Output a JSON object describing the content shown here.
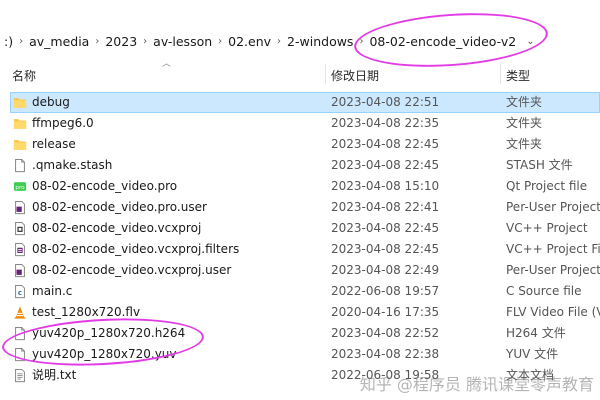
{
  "breadcrumb": {
    "items": [
      ":)",
      "av_media",
      "2023",
      "av-lesson",
      "02.env",
      "2-windows",
      "08-02-encode_video-v2"
    ]
  },
  "header": {
    "name": "名称",
    "date": "修改日期",
    "type": "类型"
  },
  "files": [
    {
      "name": "debug",
      "date": "2023-04-08 22:51",
      "type": "文件夹",
      "icon": "folder-icon"
    },
    {
      "name": "ffmpeg6.0",
      "date": "2023-04-08 22:35",
      "type": "文件夹",
      "icon": "folder-icon"
    },
    {
      "name": "release",
      "date": "2023-04-08 22:45",
      "type": "文件夹",
      "icon": "folder-icon"
    },
    {
      "name": ".qmake.stash",
      "date": "2023-04-08 22:45",
      "type": "STASH 文件",
      "icon": "file-icon"
    },
    {
      "name": "08-02-encode_video.pro",
      "date": "2023-04-08 15:10",
      "type": "Qt Project file",
      "icon": "qt-pro-icon"
    },
    {
      "name": "08-02-encode_video.pro.user",
      "date": "2023-04-08 22:41",
      "type": "Per-User Project",
      "icon": "user-project-icon"
    },
    {
      "name": "08-02-encode_video.vcxproj",
      "date": "2023-04-08 22:45",
      "type": "VC++ Project",
      "icon": "vcxproj-icon"
    },
    {
      "name": "08-02-encode_video.vcxproj.filters",
      "date": "2023-04-08 22:45",
      "type": "VC++ Project Filt",
      "icon": "vcxproj-filters-icon"
    },
    {
      "name": "08-02-encode_video.vcxproj.user",
      "date": "2023-04-08 22:49",
      "type": "Per-User Project",
      "icon": "user-project-icon"
    },
    {
      "name": "main.c",
      "date": "2022-06-08 19:57",
      "type": "C Source file",
      "icon": "c-source-icon"
    },
    {
      "name": "test_1280x720.flv",
      "date": "2020-04-16 17:35",
      "type": "FLV Video File (V",
      "icon": "vlc-icon"
    },
    {
      "name": "yuv420p_1280x720.h264",
      "date": "2023-04-08 22:52",
      "type": "H264 文件",
      "icon": "file-icon"
    },
    {
      "name": "yuv420p_1280x720.yuv",
      "date": "2023-04-08 22:38",
      "type": "YUV 文件",
      "icon": "file-icon"
    },
    {
      "name": "说明.txt",
      "date": "2022-06-08 19:58",
      "type": "文本文档",
      "icon": "text-file-icon"
    }
  ],
  "selected_index": 0,
  "watermark": "知乎 @程序员 腾讯课堂零声教育"
}
